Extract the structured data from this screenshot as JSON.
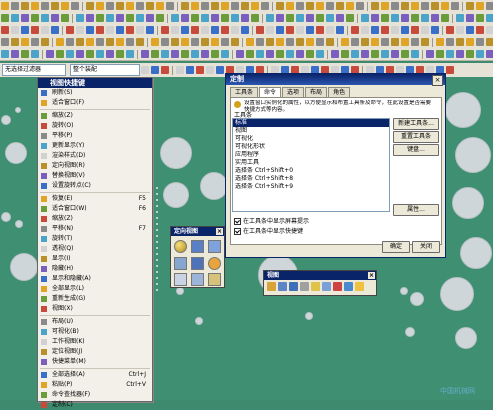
{
  "toolbar": {
    "filter_combo": "整个装配",
    "scope_combo": "无选择过滤器"
  },
  "context_menu": {
    "title": "视图快捷键",
    "items": [
      {
        "label": "刷新(S)",
        "shortcut": ""
      },
      {
        "label": "适合窗口(F)",
        "shortcut": ""
      },
      {
        "label": "缩放(Z)",
        "shortcut": ""
      },
      {
        "label": "旋转(O)",
        "shortcut": ""
      },
      {
        "label": "平移(P)",
        "shortcut": ""
      },
      {
        "label": "更新显示(Y)",
        "shortcut": ""
      },
      {
        "label": "渲染样式(D)",
        "shortcut": ""
      },
      {
        "label": "定向视图(R)",
        "shortcut": ""
      },
      {
        "label": "替换视图(V)",
        "shortcut": ""
      },
      {
        "label": "设置旋转点(C)",
        "shortcut": ""
      },
      {
        "label": "恢复(E)",
        "shortcut": "F5"
      },
      {
        "label": "适合窗口(W)",
        "shortcut": "F6"
      },
      {
        "label": "缩放(Z)",
        "shortcut": ""
      },
      {
        "label": "平移(N)",
        "shortcut": "F7"
      },
      {
        "label": "旋转(T)",
        "shortcut": ""
      },
      {
        "label": "透视(Q)",
        "shortcut": ""
      },
      {
        "label": "显示(I)",
        "shortcut": ""
      },
      {
        "label": "隐藏(H)",
        "shortcut": ""
      },
      {
        "label": "显示和隐藏(A)",
        "shortcut": ""
      },
      {
        "label": "全部显示(L)",
        "shortcut": ""
      },
      {
        "label": "重新生成(G)",
        "shortcut": ""
      },
      {
        "label": "视图(X)",
        "shortcut": ""
      },
      {
        "label": "布局(U)",
        "shortcut": ""
      },
      {
        "label": "可视化(B)",
        "shortcut": ""
      },
      {
        "label": "工作视图(K)",
        "shortcut": ""
      },
      {
        "label": "定位视图(J)",
        "shortcut": ""
      },
      {
        "label": "快捷菜单(M)",
        "shortcut": ""
      },
      {
        "label": "全部选择(A)",
        "shortcut": "Ctrl+J"
      },
      {
        "label": "粘贴(P)",
        "shortcut": "Ctrl+V"
      },
      {
        "label": "命令查找器(F)",
        "shortcut": ""
      },
      {
        "label": "定制(C)",
        "shortcut": ""
      }
    ]
  },
  "dialog": {
    "title": "定制",
    "tabs": [
      "工具条",
      "命令",
      "选项",
      "布局",
      "角色"
    ],
    "description": "设置窗口实例化的属性，以方便显示和布置工具条及命令，在此设置是否需要快捷方式等内容。",
    "list_header": "工具条",
    "toolbar_list": [
      "标准",
      "视图",
      "可视化",
      "可视化形状",
      "应用程序",
      "实用工具",
      "选择条 Ctrl+Shift+0",
      "选择条 Ctrl+Shift+8",
      "选择条 Ctrl+Shift+9"
    ],
    "buttons": {
      "new": "新建工具条...",
      "reset": "重置工具条",
      "keyboard": "键盘...",
      "properties": "属性...",
      "ok": "确定",
      "close": "关闭"
    },
    "checkboxes": [
      "在工具条中显示屏幕提示",
      "在工具条中显示快捷键"
    ]
  },
  "floating_toolbar_1": {
    "title": "定向视图"
  },
  "floating_toolbar_2": {
    "title": "视图"
  },
  "watermark": "中国机械网"
}
